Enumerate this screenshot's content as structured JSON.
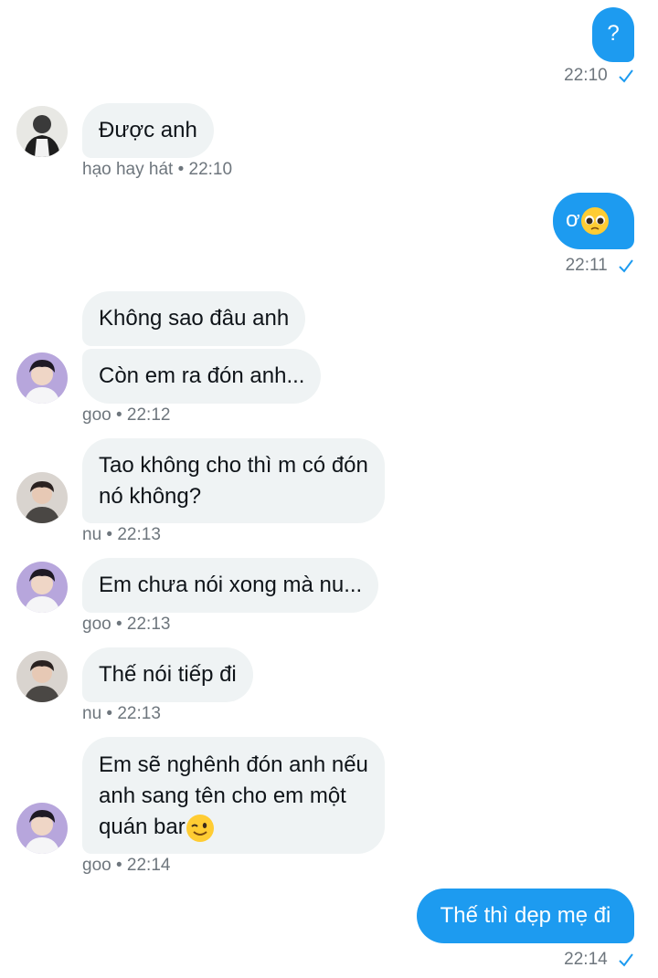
{
  "messages": {
    "m1": {
      "text": "?",
      "time": "22:10"
    },
    "m2": {
      "text": "Được anh",
      "meta": "hạo hay hát • 22:10"
    },
    "m3": {
      "text": "ơ",
      "time": "22:11",
      "emoji": "pleading-face-emoji"
    },
    "m4a": {
      "text": "Không sao đâu anh"
    },
    "m4b": {
      "text": "Còn em ra đón anh...",
      "meta": "goo • 22:12"
    },
    "m5": {
      "line1": "Tao không cho thì m có đón",
      "line2": "nó không?",
      "meta": "nu • 22:13"
    },
    "m6": {
      "text": "Em chưa nói xong mà nu...",
      "meta": "goo • 22:13"
    },
    "m7": {
      "text": "Thế nói tiếp đi",
      "meta": "nu • 22:13"
    },
    "m8": {
      "line1": "Em sẽ nghênh đón anh nếu",
      "line2": "anh sang tên cho em một",
      "line3": "quán bar",
      "emoji": "winking-face-emoji",
      "meta": "goo • 22:14"
    },
    "m9": {
      "text": "Thế thì dẹp mẹ đi",
      "time": "22:14"
    }
  },
  "colors": {
    "outgoing": "#1d9bf0",
    "incoming": "#eff3f4",
    "meta": "#6e767d",
    "check": "#1d9bf0"
  }
}
